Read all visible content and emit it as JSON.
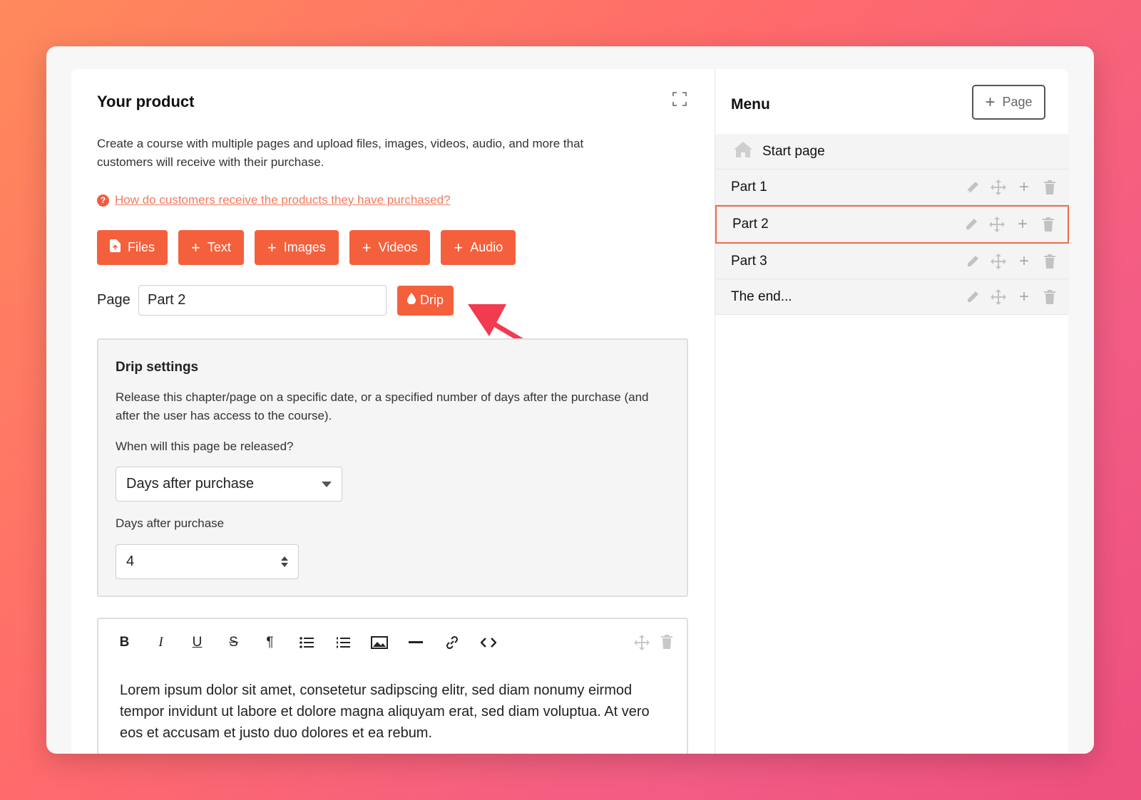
{
  "product": {
    "title": "Your product",
    "description": "Create a course with multiple pages and upload files, images, videos, audio, and more that customers will receive with their purchase.",
    "help_link": "How do customers receive the products they have purchased?",
    "help_icon": "?",
    "buttons": [
      {
        "label": "Files",
        "icon": "file-icon"
      },
      {
        "label": "Text",
        "icon": "plus-icon"
      },
      {
        "label": "Images",
        "icon": "plus-icon"
      },
      {
        "label": "Videos",
        "icon": "plus-icon"
      },
      {
        "label": "Audio",
        "icon": "plus-icon"
      }
    ],
    "page_label": "Page",
    "page_value": "Part 2",
    "drip_label": "Drip"
  },
  "drip": {
    "title": "Drip settings",
    "description": "Release this chapter/page on a specific date, or a specified number of days after the purchase (and after the user has access to the course).",
    "when_label": "When will this page be released?",
    "when_value": "Days after purchase",
    "days_label": "Days after purchase",
    "days_value": "4"
  },
  "editor": {
    "toolbar": {
      "bold": "B",
      "italic": "I",
      "underline": "U",
      "strike": "S",
      "paragraph": "¶"
    },
    "content": "Lorem ipsum dolor sit amet, consetetur sadipscing elitr, sed diam nonumy eirmod tempor invidunt ut labore et dolore magna aliquyam erat, sed diam voluptua. At vero eos et accusam et justo duo dolores et ea rebum."
  },
  "menu": {
    "title": "Menu",
    "add_page_label": "Page",
    "start_page": "Start page",
    "items": [
      {
        "label": "Part 1"
      },
      {
        "label": "Part 2",
        "selected": true
      },
      {
        "label": "Part 3"
      },
      {
        "label": "The end..."
      }
    ]
  },
  "colors": {
    "accent": "#f5603c",
    "selected_border": "#f06a4a",
    "arrow": "#f23a50"
  }
}
